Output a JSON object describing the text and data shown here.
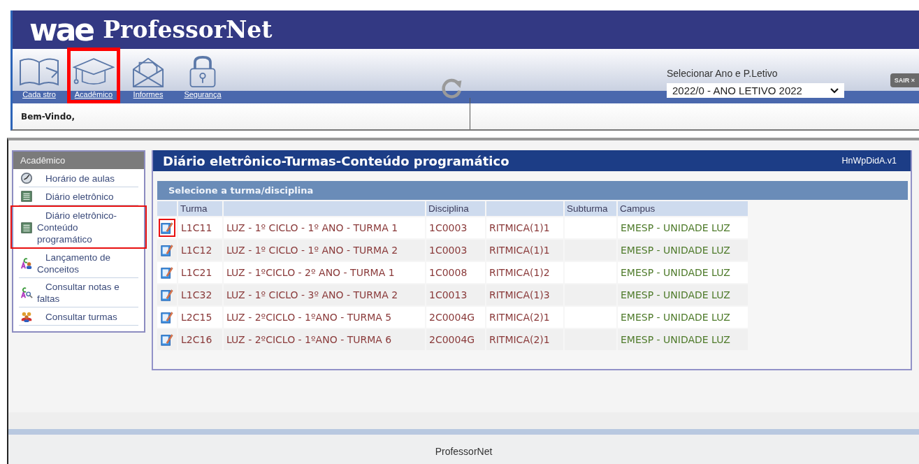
{
  "header": {
    "logo": "wae",
    "product": "ProfessorNet"
  },
  "toolbar": {
    "items": [
      {
        "label": "Cada stro",
        "kind": "book",
        "highlighted": false
      },
      {
        "label": "Acadêmico",
        "kind": "cap",
        "highlighted": true
      },
      {
        "label": "Informes",
        "kind": "envelope",
        "highlighted": false
      },
      {
        "label": "Segurança",
        "kind": "lock",
        "highlighted": false
      }
    ]
  },
  "period_selector": {
    "label": "Selecionar Ano e P.Letivo",
    "value": "2022/0 - ANO LETIVO 2022"
  },
  "logout_button": "SAIR ×",
  "welcome": "Bem-Vindo,",
  "sidebar": {
    "title": "Acadêmico",
    "items": [
      {
        "label": "Horário de aulas",
        "kind": "clock",
        "highlighted": false
      },
      {
        "label": "Diário eletrônico",
        "kind": "ledger",
        "highlighted": false
      },
      {
        "label": "Diário eletrônico-Conteúdo programático",
        "kind": "ledger",
        "highlighted": true
      },
      {
        "label": "Lançamento de Conceitos",
        "kind": "grades",
        "highlighted": false
      },
      {
        "label": "Consultar notas e faltas",
        "kind": "search",
        "highlighted": false
      },
      {
        "label": "Consultar turmas",
        "kind": "people",
        "highlighted": false
      }
    ]
  },
  "panel": {
    "title": "Diário eletrônico-Turmas-Conteúdo programático",
    "code": "HnWpDidA.v1",
    "subtitle": "Selecione a turma/disciplina",
    "table": {
      "columns": [
        "Turma",
        "Disciplina",
        "Subturma",
        "Campus"
      ],
      "rows": [
        {
          "turma": "L1C11",
          "name": "LUZ - 1º CICLO - 1º ANO - TURMA 1",
          "disciplina": "1C0003",
          "column_5": "RITMICA(1)1",
          "campus": "EMESP - UNIDADE LUZ",
          "highlighted": true
        },
        {
          "turma": "L1C12",
          "name": "LUZ - 1º CICLO - 1º ANO - TURMA 2",
          "disciplina": "1C0003",
          "column_5": "RITMICA(1)1",
          "campus": "EMESP - UNIDADE LUZ",
          "highlighted": false
        },
        {
          "turma": "L1C21",
          "name": "LUZ - 1ºCICLO - 2º ANO - TURMA 1",
          "disciplina": "1C0008",
          "column_5": "RITMICA(1)2",
          "campus": "EMESP - UNIDADE LUZ",
          "highlighted": false
        },
        {
          "turma": "L1C32",
          "name": "LUZ - 1º CICLO - 3º ANO - TURMA 2",
          "disciplina": "1C0013",
          "column_5": "RITMICA(1)3",
          "campus": "EMESP - UNIDADE LUZ",
          "highlighted": false
        },
        {
          "turma": "L2C15",
          "name": "LUZ - 2ºCICLO - 1ºANO - TURMA 5",
          "disciplina": "2C0004G",
          "column_5": "RITMICA(2)1",
          "campus": "EMESP - UNIDADE LUZ",
          "highlighted": false
        },
        {
          "turma": "L2C16",
          "name": "LUZ - 2ºCICLO - 1ºANO - TURMA 6",
          "disciplina": "2C0004G",
          "column_5": "RITMICA(2)1",
          "campus": "EMESP - UNIDADE LUZ",
          "highlighted": false
        }
      ]
    }
  },
  "footer": "ProfessorNet"
}
